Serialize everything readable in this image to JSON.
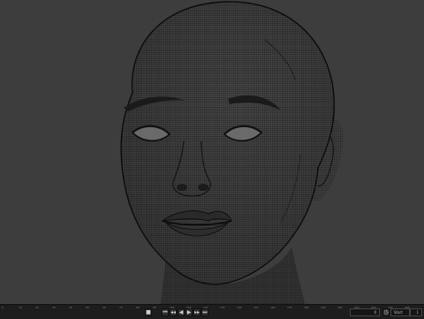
{
  "viewport": {
    "object": "head-wireframe-mesh",
    "background_color": "#3d3d3d",
    "wire_color": "#101010"
  },
  "timeline": {
    "ticks": [
      "0",
      "10",
      "20",
      "30",
      "40",
      "50",
      "60",
      "70",
      "80",
      "90",
      "100",
      "110",
      "120",
      "130",
      "140",
      "150",
      "160",
      "170",
      "180",
      "190",
      "200",
      "210",
      "220",
      "230",
      "240"
    ],
    "controls": {
      "stop_icon": "stop-icon",
      "jump_start_icon": "jump-start-icon",
      "prev_key_icon": "prev-keyframe-icon",
      "play_reverse_icon": "play-reverse-icon",
      "play_icon": "play-icon",
      "next_key_icon": "next-keyframe-icon",
      "jump_end_icon": "jump-end-icon"
    },
    "frame_value": "0",
    "start_label": "Start",
    "start_value": "1"
  }
}
